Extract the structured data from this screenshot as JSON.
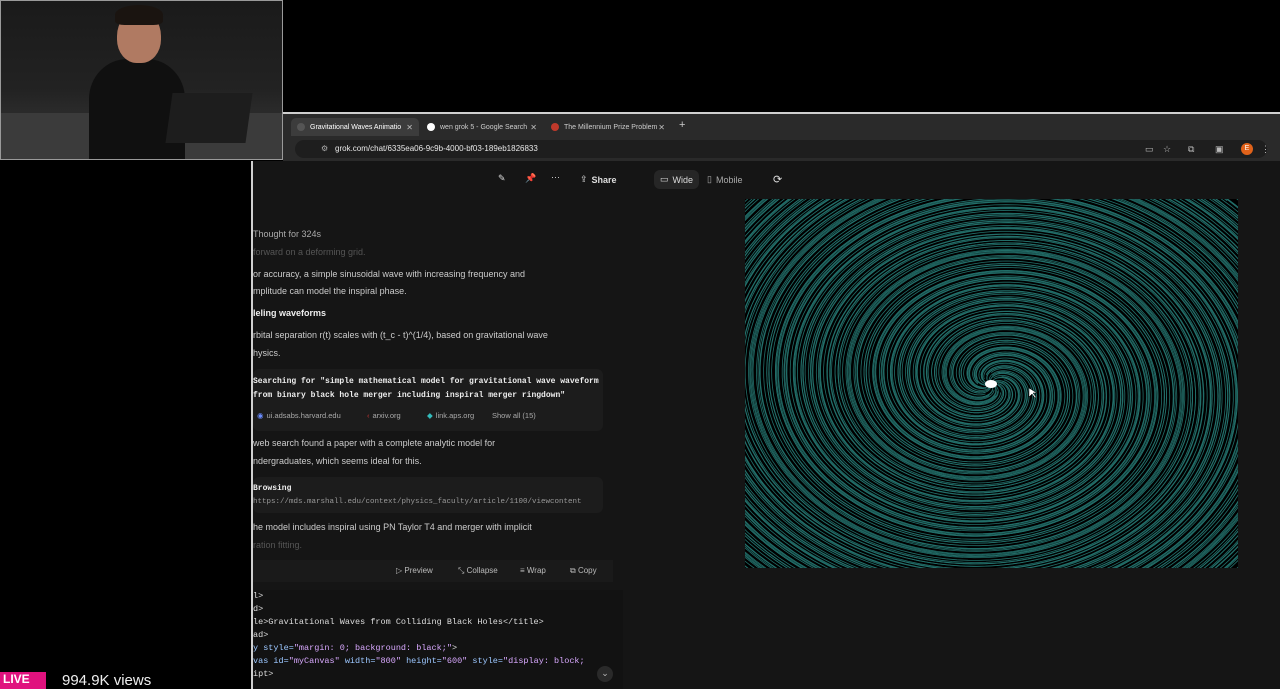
{
  "browser": {
    "tabs": [
      {
        "label": "Gravitational Waves Animatio",
        "active": true,
        "favicon_color": "#2a2a2a"
      },
      {
        "label": "wen grok 5 - Google Search",
        "active": false,
        "favicon_color": "#ffffff"
      },
      {
        "label": "The Millennium Prize Problem",
        "active": false,
        "favicon_color": "#c0392b"
      }
    ],
    "new_tab_label": "+",
    "url": "grok.com/chat/6335ea06-9c9b-4000-bf03-189eb1826833",
    "profile_initial": "E"
  },
  "toolbar": {
    "share_label": "Share",
    "wide_label": "Wide",
    "mobile_label": "Mobile"
  },
  "chat": {
    "thought_label": "Thought for 324s",
    "faded_top": "forward on a deforming grid.",
    "para1_line1": "or accuracy, a simple sinusoidal wave with increasing frequency and",
    "para1_line2": "mplitude can model the inspiral phase.",
    "heading": "leling waveforms",
    "para2_line1": "rbital separation r(t) scales with (t_c - t)^(1/4), based on gravitational wave",
    "para2_line2": "hysics.",
    "search_line1": "Searching for \"simple mathematical model for gravitational wave waveform",
    "search_line2": "from binary black hole merger including inspiral merger ringdown\"",
    "sources": [
      "ui.adsabs.harvard.edu",
      "arxiv.org",
      "link.aps.org"
    ],
    "show_all": "Show all (15)",
    "para3_line1": "web search found a paper with a complete analytic model for",
    "para3_line2": "ndergraduates, which seems ideal for this.",
    "browsing_label": "Browsing",
    "browsing_url": "https://mds.marshall.edu/context/physics_faculty/article/1100/viewcontent",
    "para4_line1": "he model includes inspiral using PN Taylor T4 and merger with implicit",
    "para4_faded": "ration fitting."
  },
  "codebar": {
    "preview": "Preview",
    "collapse": "Collapse",
    "wrap": "Wrap",
    "copy": "Copy"
  },
  "code": {
    "line1": "l>",
    "line2": "d>",
    "line3": "le>Gravitational Waves from Colliding Black Holes</title>",
    "line4": "ad>",
    "line5_a": "y style=",
    "line5_b": "\"margin: 0; background: black;\"",
    "line5_c": ">",
    "line6_a": "vas id=",
    "line6_b": "\"myCanvas\"",
    "line6_c": " width=",
    "line6_d": "\"800\"",
    "line6_e": " height=",
    "line6_f": "\"600\"",
    "line6_g": " style=",
    "line6_h": "\"display: block;",
    "line7": "ipt>"
  },
  "stream": {
    "live_label": "LIVE",
    "views": "994.9K views"
  },
  "colors": {
    "wave": "#3fc9c0",
    "live": "#e0127e"
  }
}
